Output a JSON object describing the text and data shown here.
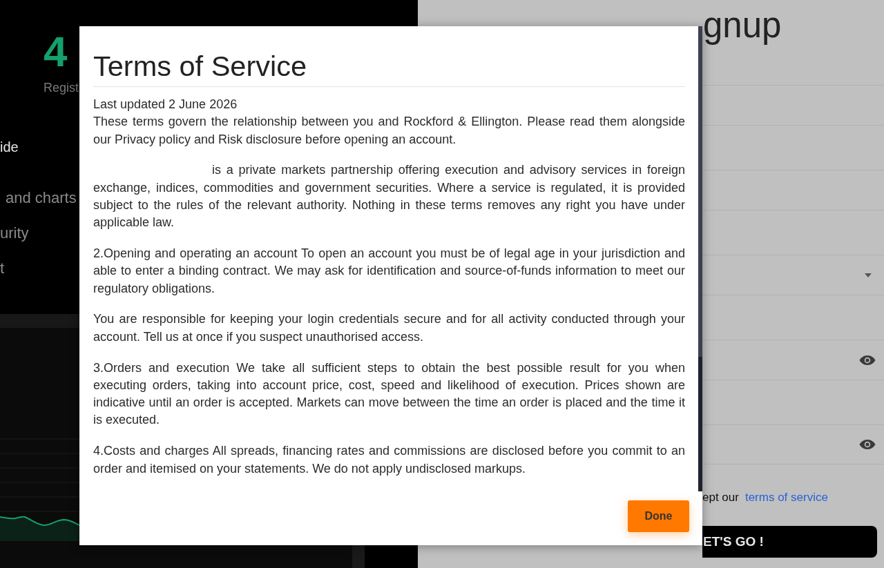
{
  "dashboard": {
    "stat": {
      "value": "4",
      "label": "Regist"
    },
    "sidebar": {
      "heading": "ide",
      "items": [
        {
          "label": "and charts"
        },
        {
          "label": "urity"
        },
        {
          "label": "t"
        }
      ]
    }
  },
  "signup": {
    "title": "gnup",
    "fields": [
      {
        "kind": "text"
      },
      {
        "kind": "text"
      },
      {
        "kind": "text"
      },
      {
        "kind": "text"
      },
      {
        "kind": "select"
      },
      {
        "kind": "text"
      },
      {
        "kind": "password"
      },
      {
        "kind": "text"
      },
      {
        "kind": "password"
      }
    ],
    "terms": {
      "text": "ept our",
      "link": "terms of service"
    },
    "submit": "ET'S GO !"
  },
  "modal": {
    "title": "Terms of Service",
    "updated": "Last updated 2 June 2026",
    "paragraphs": [
      {
        "kind": "plain",
        "text": "These terms govern the relationship between you and Rockford & Ellington. Please read them alongside our Privacy policy and Risk disclosure before opening an account."
      },
      {
        "kind": "indented",
        "text": "is a private markets partnership offering execution and advisory services in foreign exchange, indices, commodities and government securities. Where a service is regulated, it is provided subject to the rules of the relevant authority. Nothing in these terms removes any right you have under applicable law."
      },
      {
        "kind": "plain",
        "text": "2.Opening and operating an account To open an account you must be of legal age in your jurisdiction and able to enter a binding contract. We may ask for identification and source-of-funds information to meet our regulatory obligations."
      },
      {
        "kind": "plain",
        "text": "You are responsible for keeping your login credentials secure and for all activity conducted through your account. Tell us at once if you suspect unauthorised access."
      },
      {
        "kind": "plain",
        "text": "3.Orders and execution We take all sufficient steps to obtain the best possible result for you when executing orders, taking into account price, cost, speed and likelihood of execution. Prices shown are indicative until an order is accepted. Markets can move between the time an order is placed and the time it is executed."
      },
      {
        "kind": "plain",
        "text": "4.Costs and charges All spreads, financing rates and commissions are disclosed before you commit to an order and itemised on your statements. We do not apply undisclosed markups."
      }
    ],
    "button": "Done"
  }
}
